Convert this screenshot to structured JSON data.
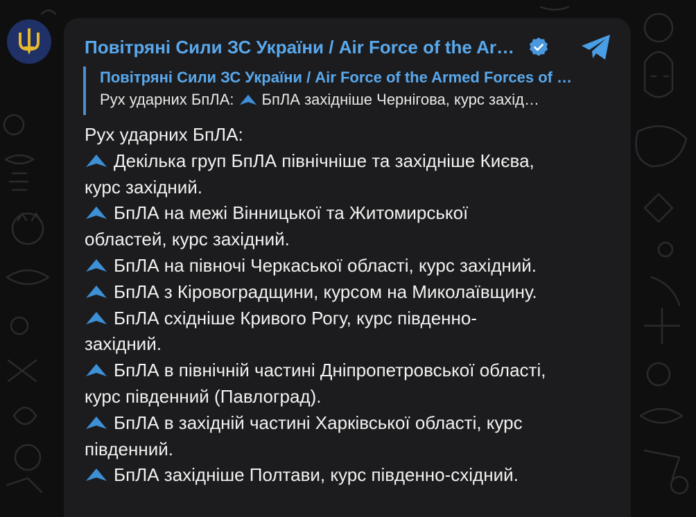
{
  "channel": {
    "name": "Повітряні Сили ЗС України / Air Force of the Ar…",
    "avatar_icon": "trident-icon",
    "verified_icon": "verified-badge-icon",
    "share_icon": "telegram-share-icon"
  },
  "reply": {
    "title": "Повітряні Сили ЗС України / Air Force of the Armed Forces of …",
    "text_prefix": "Рух ударних БпЛА:",
    "text_suffix": "БпЛА західніше Чернігова, курс захід…"
  },
  "message": {
    "heading": "Рух ударних БпЛА:",
    "lines": [
      "Декілька груп БпЛА північніше та західніше Києва,",
      "курс західний.",
      "БпЛА на межі Вінницької та Житомирської",
      "областей, курс західний.",
      "БпЛА на півночі Черкаської області, курс західний.",
      "БпЛА з Кіровоградщини, курсом на Миколаївщину.",
      "БпЛА східніше Кривого Рогу, курс південно-",
      "західний.",
      "БпЛА в північній частині Дніпропетровської області,",
      "курс південний (Павлоград).",
      "БпЛА в західній частині Харківської області, курс",
      "південний.",
      "БпЛА західніше Полтави, курс південно-східний."
    ],
    "drone_icon": "drone-icon"
  },
  "colors": {
    "accent": "#59a8ec",
    "bubble": "#1c1c1e",
    "background": "#0f0f10",
    "text": "#f2f2f2",
    "drone": "#3d8fd6"
  }
}
